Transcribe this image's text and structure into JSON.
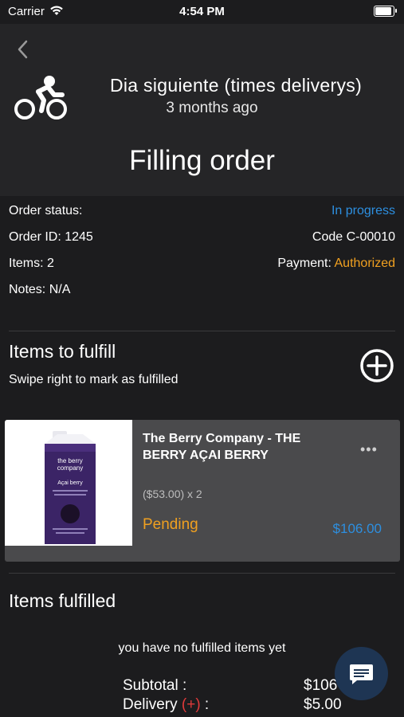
{
  "status_bar": {
    "carrier": "Carrier",
    "time": "4:54 PM"
  },
  "header": {
    "courier": "Dia siguiente (times deliverys)",
    "time_ago": "3 months ago",
    "title": "Filling order"
  },
  "order": {
    "status_label": "Order status:",
    "status_value": "In progress",
    "id_label": "Order ID: 1245",
    "code": "Code C-00010",
    "items_label": "Items: 2",
    "payment_label": "Payment:",
    "payment_value": "Authorized",
    "notes": "Notes: N/A"
  },
  "to_fulfill": {
    "title": "Items to fulfill",
    "hint": "Swipe right to mark as fulfilled"
  },
  "item": {
    "name": "The Berry Company - THE BERRY AÇAI BERRY",
    "qty_text": "($53.00) x 2",
    "status": "Pending",
    "total": "$106.00",
    "menu": "•••",
    "image_text": {
      "brand_line1": "the berry",
      "brand_line2": "company",
      "product": "Açai berry"
    }
  },
  "fulfilled": {
    "title": "Items fulfilled",
    "empty_text": "you have no fulfilled items yet"
  },
  "summary": {
    "subtotal_label": "Subtotal :",
    "subtotal_value": "$106",
    "delivery_label": "Delivery",
    "delivery_sign": "(+)",
    "delivery_colon": " :",
    "delivery_value": "$5.00"
  },
  "colors": {
    "background": "#1c1c1e",
    "header": "#252527",
    "card": "#4a4a4c",
    "accent_blue": "#2d8fe0",
    "accent_orange": "#f0a020",
    "red": "#e03a3a",
    "fab": "#1e3553"
  },
  "icons": {
    "back": "chevron-left-icon",
    "courier": "bicycle-icon",
    "add": "plus-circle-icon",
    "menu": "more-horizontal-icon",
    "chat": "chat-icon"
  }
}
